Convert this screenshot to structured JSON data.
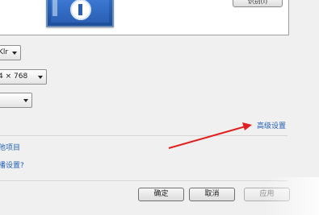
{
  "detect_button": {
    "label": "识别(I)"
  },
  "display_select": {
    "value": "Klr"
  },
  "resolution_select": {
    "value": "4 × 768"
  },
  "orientation_select": {
    "value": ""
  },
  "advanced_link": "高级设置",
  "links": {
    "other_items": "他项目",
    "display_settings": "播设置?"
  },
  "buttons": {
    "ok": "确定",
    "cancel": "取消",
    "apply": "应用"
  },
  "colors": {
    "link": "#1f5fb5",
    "annotation_arrow": "#e02020"
  }
}
